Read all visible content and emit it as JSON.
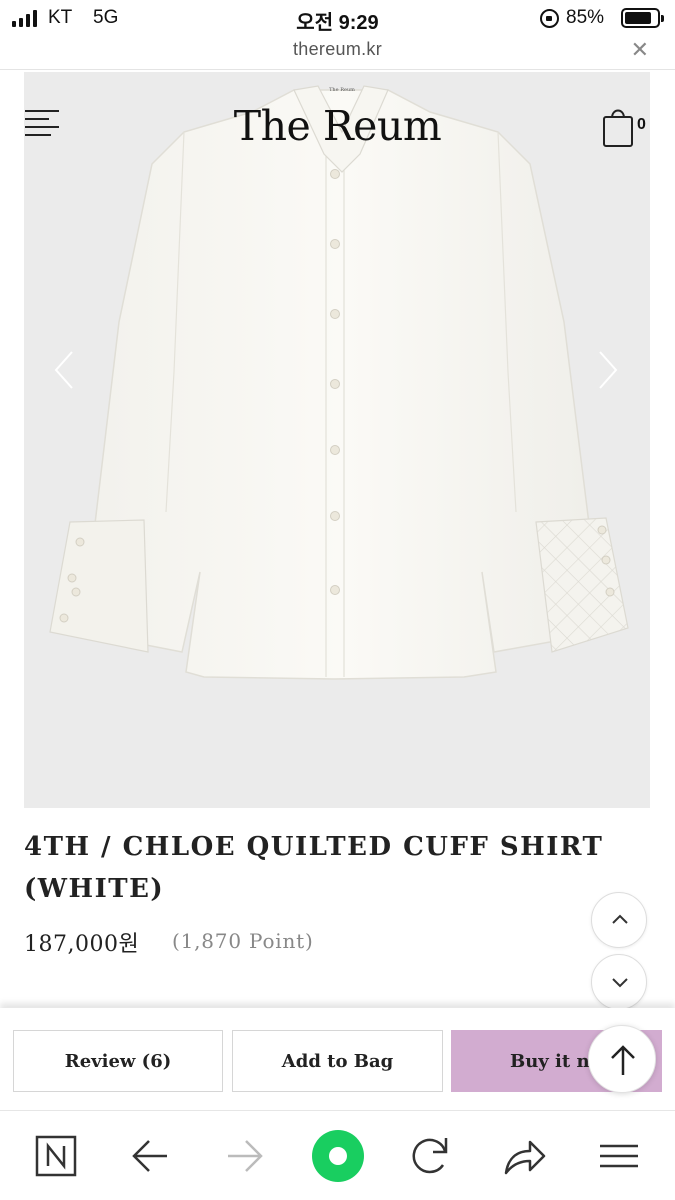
{
  "status_bar": {
    "carrier": "KT",
    "network": "5G",
    "time": "오전 9:29",
    "battery_percent": "85%",
    "battery_level": 0.85
  },
  "url_bar": {
    "url": "thereum.kr",
    "close_icon": "close-icon"
  },
  "header": {
    "logo": "The Reum",
    "menu_icon": "hamburger-menu-icon",
    "cart_icon": "shopping-bag-icon",
    "cart_count": "0"
  },
  "gallery": {
    "prev_icon": "chevron-left-icon",
    "next_icon": "chevron-right-icon",
    "image_description": "white oversized shirt with quilted cuffs"
  },
  "product": {
    "title": "4TH / CHLOE QUILTED CUFF SHIRT (WHITE)",
    "price": "187,000원",
    "points": "(1,870 Point)"
  },
  "scroll_controls": {
    "up_icon": "chevron-up-icon",
    "down_icon": "chevron-down-icon"
  },
  "actions": {
    "review_label": "Review (6)",
    "add_to_bag_label": "Add to Bag",
    "buy_now_label": "Buy it no",
    "buy_color": "#d2acd0",
    "back_to_top_icon": "arrow-up-icon"
  },
  "browser_toolbar": {
    "items": [
      "naver-icon",
      "back-arrow-icon",
      "forward-arrow-icon",
      "home-green-icon",
      "reload-icon",
      "share-icon",
      "menu-icon"
    ],
    "accent_color": "#19ce60"
  }
}
